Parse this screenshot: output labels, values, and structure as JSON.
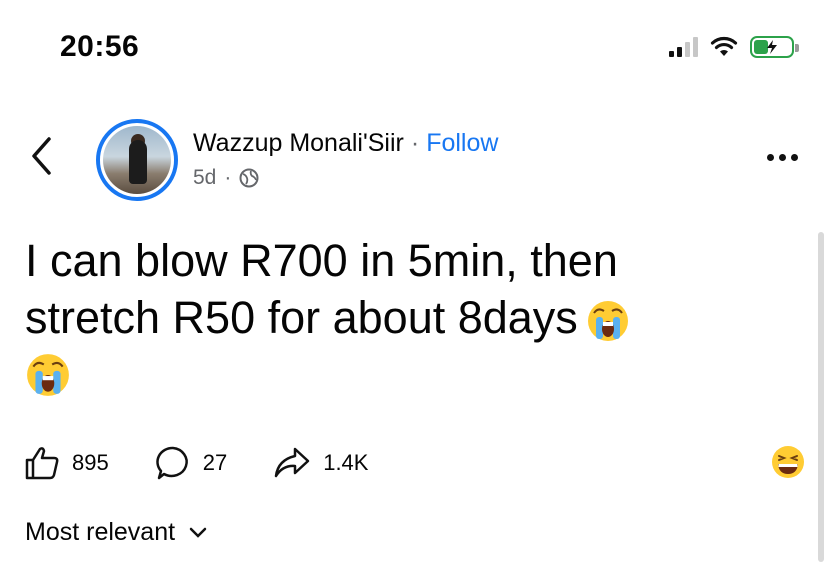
{
  "status_bar": {
    "time": "20:56"
  },
  "post": {
    "author": "Wazzup Monali'Siir",
    "separator": "·",
    "follow_label": "Follow",
    "age": "5d",
    "meta_separator": "·",
    "privacy_icon": "globe-icon",
    "text_line1": "I can blow R700 in 5min, then",
    "text_line2": "stretch R50 for about 8days",
    "emoji": "crying-face-emoji",
    "likes": "895",
    "comments": "27",
    "shares": "1.4K",
    "reaction_emoji": "laughing-face-emoji"
  },
  "comments_sort": {
    "label": "Most relevant"
  },
  "colors": {
    "accent": "#1877f2",
    "battery": "#2ca24a",
    "secondary_text": "#65676b"
  }
}
